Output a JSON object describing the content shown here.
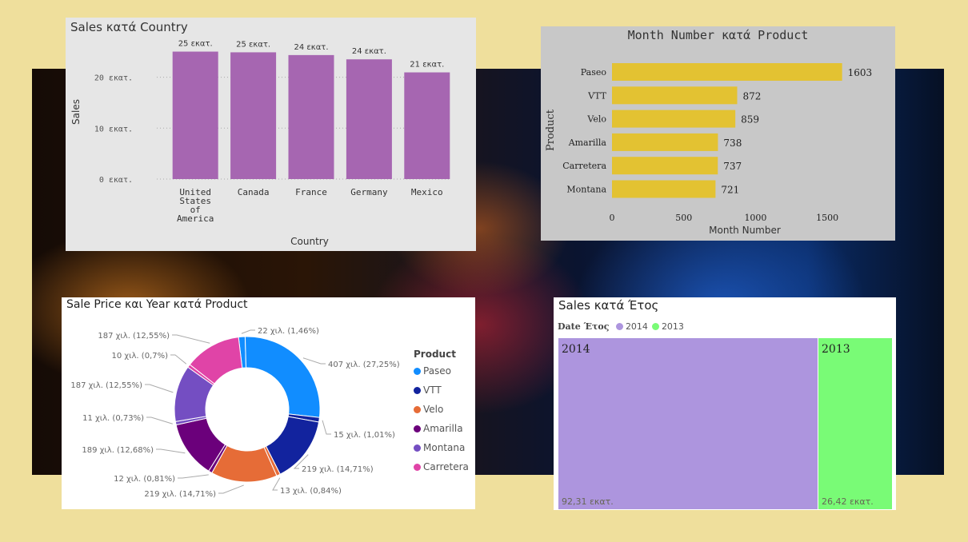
{
  "colors": {
    "purple_bar": "#a666b1",
    "yellow_bar": "#e3c232",
    "tm_2014": "#ad95de",
    "tm_2013": "#79fb76"
  },
  "chart_data": [
    {
      "type": "bar",
      "title": "Sales κατά Country",
      "xlabel": "Country",
      "ylabel": "Sales",
      "categories": [
        "United States of America",
        "Canada",
        "France",
        "Germany",
        "Mexico"
      ],
      "category_lines": [
        [
          "United",
          "States",
          "of",
          "America"
        ],
        [
          "Canada"
        ],
        [
          "France"
        ],
        [
          "Germany"
        ],
        [
          "Mexico"
        ]
      ],
      "values": [
        25.03,
        24.89,
        24.35,
        23.51,
        20.95
      ],
      "data_labels": [
        "25 εκατ.",
        "25 εκατ.",
        "24 εκατ.",
        "24 εκατ.",
        "21 εκατ."
      ],
      "yticks": [
        0,
        10,
        20
      ],
      "ytick_labels": [
        "0 εκατ.",
        "10 εκατ.",
        "20 εκατ."
      ],
      "ylim": [
        0,
        27
      ],
      "grid": true
    },
    {
      "type": "bar",
      "orientation": "horizontal",
      "title": "Month Number κατά Product",
      "xlabel": "Month Number",
      "ylabel": "Product",
      "categories": [
        "Paseo",
        "VTT",
        "Velo",
        "Amarilla",
        "Carretera",
        "Montana"
      ],
      "values": [
        1603,
        872,
        859,
        738,
        737,
        721
      ],
      "data_labels": [
        "1603",
        "872",
        "859",
        "738",
        "737",
        "721"
      ],
      "xticks": [
        0,
        500,
        1000,
        1500
      ],
      "xtick_labels": [
        "0",
        "500",
        "1000",
        "1500"
      ],
      "xlim": [
        0,
        1800
      ]
    },
    {
      "type": "pie",
      "subtype": "donut",
      "title": "Sale Price και Year κατά Product",
      "legend_title": "Product",
      "legend_position": "right",
      "legend": [
        {
          "name": "Paseo",
          "color": "#118dff"
        },
        {
          "name": "VTT",
          "color": "#12239e"
        },
        {
          "name": "Velo",
          "color": "#e66c37"
        },
        {
          "name": "Amarilla",
          "color": "#6b007b"
        },
        {
          "name": "Montana",
          "color": "#744ec2"
        },
        {
          "name": "Carretera",
          "color": "#e044a7"
        }
      ],
      "slices": [
        {
          "label": "22 χιλ. (1,46%)",
          "value": 1.46,
          "color": "#118dff"
        },
        {
          "label": "407 χιλ. (27,25%)",
          "value": 27.25,
          "color": "#118dff"
        },
        {
          "label": "15 χιλ. (1,01%)",
          "value": 1.01,
          "color": "#12239e"
        },
        {
          "label": "219 χιλ. (14,71%)",
          "value": 14.71,
          "color": "#12239e"
        },
        {
          "label": "13 χιλ. (0,84%)",
          "value": 0.84,
          "color": "#e66c37"
        },
        {
          "label": "219 χιλ. (14,71%)",
          "value": 14.71,
          "color": "#e66c37"
        },
        {
          "label": "12 χιλ. (0,81%)",
          "value": 0.81,
          "color": "#6b007b"
        },
        {
          "label": "189 χιλ. (12,68%)",
          "value": 12.68,
          "color": "#6b007b"
        },
        {
          "label": "11 χιλ. (0,73%)",
          "value": 0.73,
          "color": "#744ec2"
        },
        {
          "label": "187 χιλ. (12,55%)",
          "value": 12.55,
          "color": "#744ec2"
        },
        {
          "label": "10 χιλ. (0,7%)",
          "value": 0.7,
          "color": "#e044a7"
        },
        {
          "label": "187 χιλ. (12,55%)",
          "value": 12.55,
          "color": "#e044a7"
        }
      ]
    },
    {
      "type": "treemap",
      "title": "Sales κατά Έτος",
      "legend_title": "Date Έτος",
      "legend_position": "top-left",
      "items": [
        {
          "name": "2014",
          "value": 92.31,
          "value_label": "92,31 εκατ.",
          "color": "#ad95de"
        },
        {
          "name": "2013",
          "value": 26.42,
          "value_label": "26,42 εκατ.",
          "color": "#79fb76"
        }
      ]
    }
  ]
}
